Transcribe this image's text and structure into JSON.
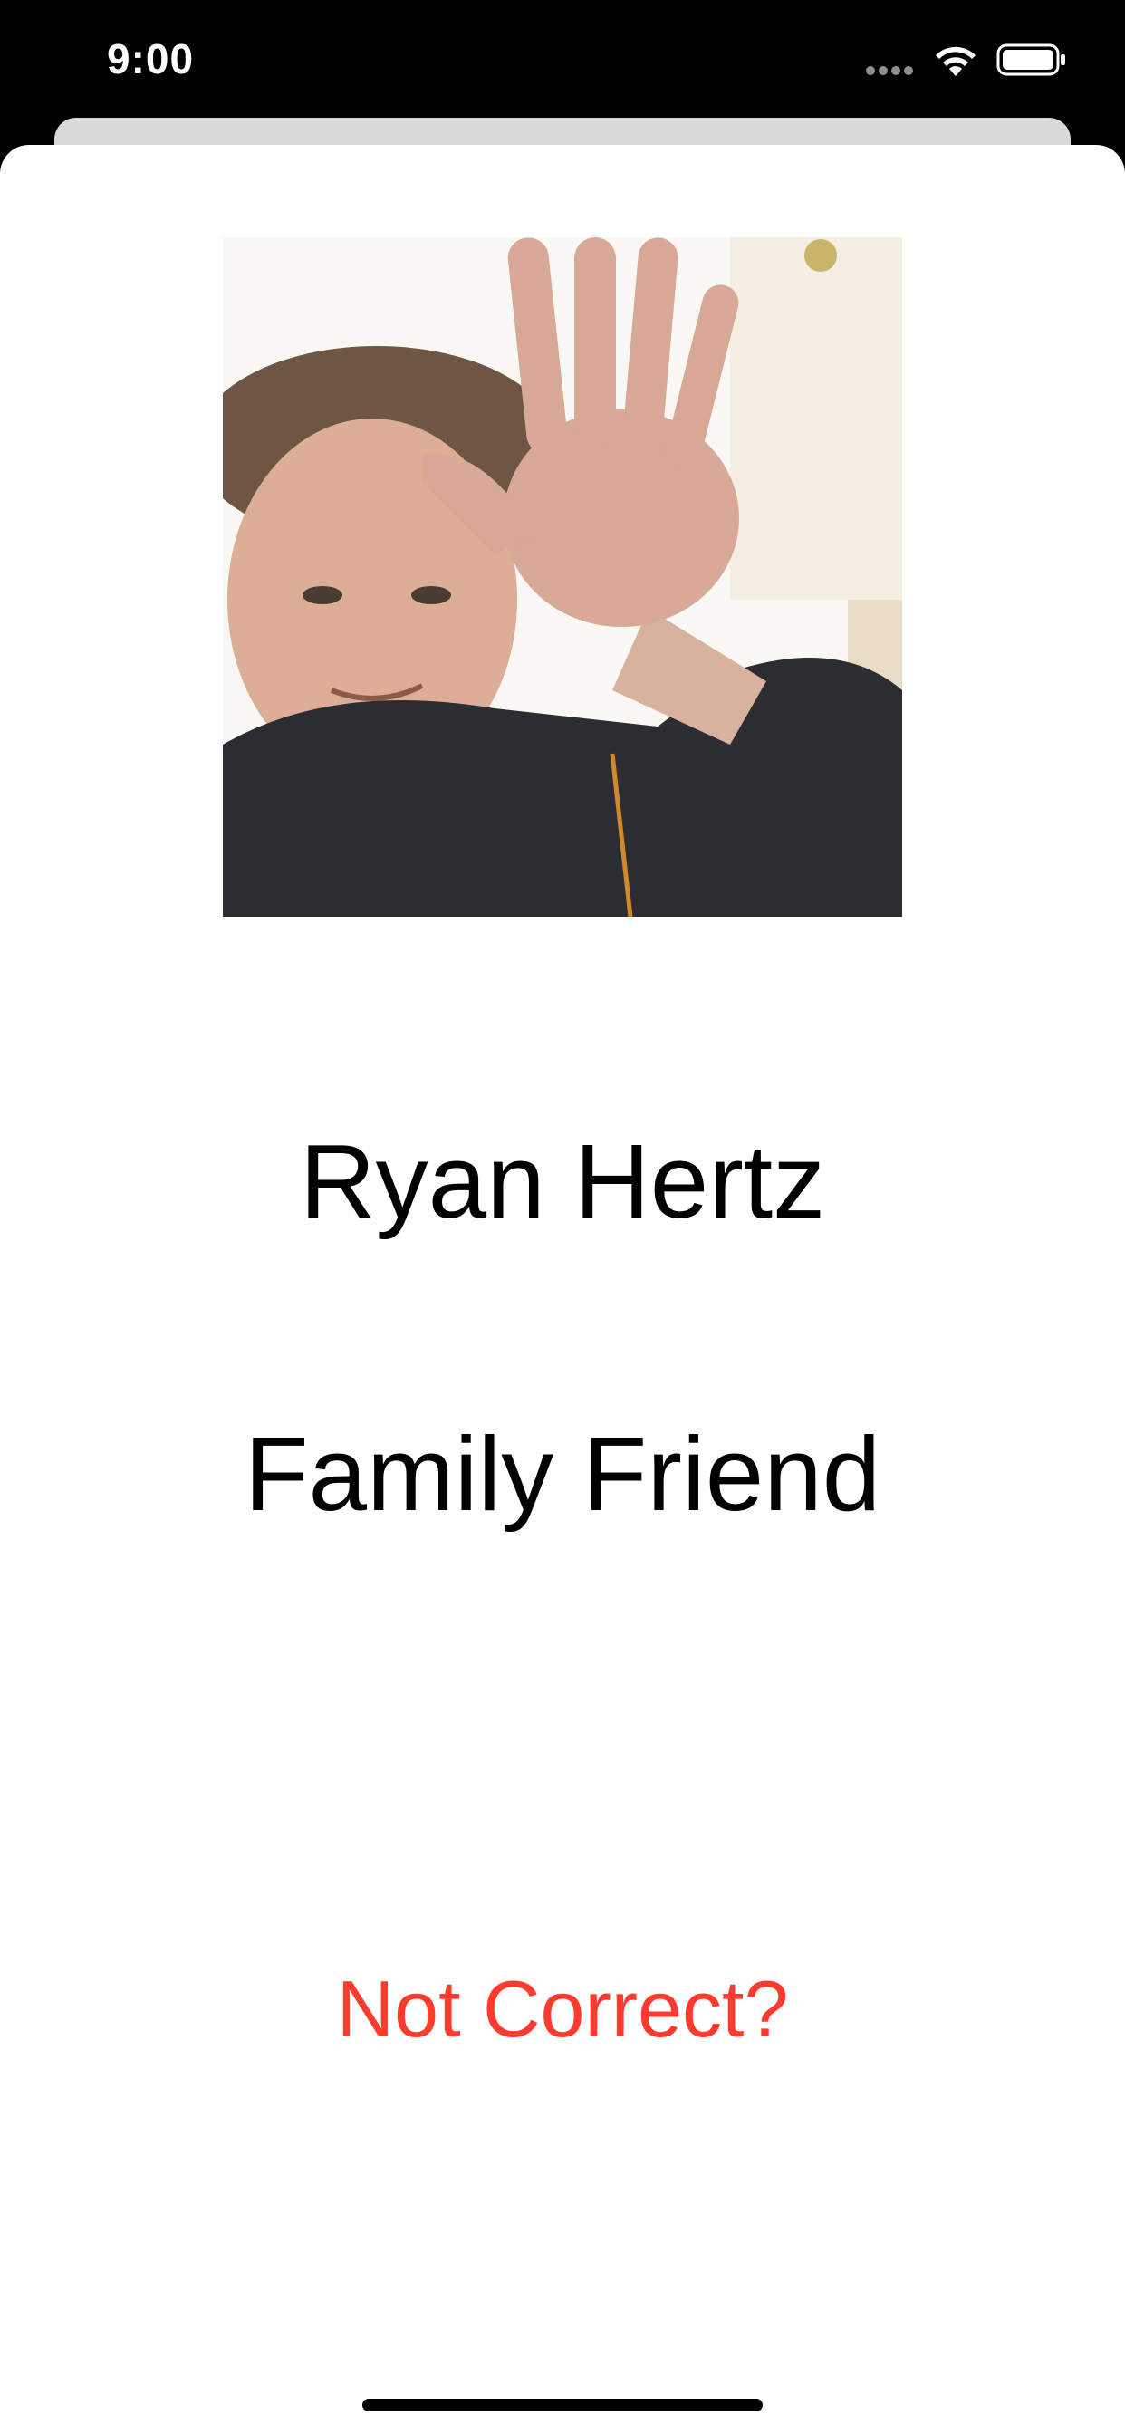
{
  "status_bar": {
    "time": "9:00",
    "icons": [
      "cellular-signal-icon",
      "wifi-icon",
      "battery-icon"
    ]
  },
  "contact": {
    "photo_alt": "Photo of person waving",
    "name": "Ryan Hertz",
    "relationship": "Family Friend"
  },
  "actions": {
    "not_correct_label": "Not Correct?"
  },
  "colors": {
    "accent": "#ff3b30",
    "text": "#000000",
    "background": "#ffffff",
    "status_bar": "#000000"
  }
}
